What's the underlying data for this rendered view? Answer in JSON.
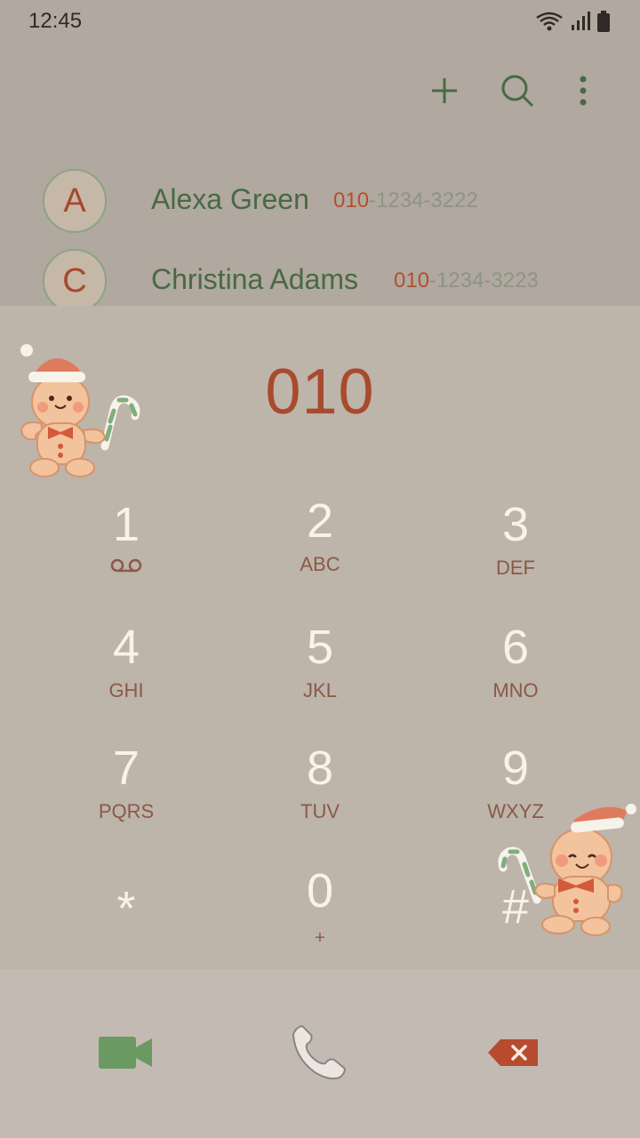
{
  "status_bar": {
    "time": "12:45"
  },
  "toolbar": {
    "icons": [
      "plus-icon",
      "search-icon",
      "more-vert-icon"
    ]
  },
  "contacts": [
    {
      "initial": "A",
      "name": "Alexa Green",
      "number_match": "010",
      "number_rest": "-1234-3222"
    },
    {
      "initial": "C",
      "name": "Christina Adams",
      "number_match": "010",
      "number_rest": "-1234-3223"
    }
  ],
  "dialer": {
    "number": "010"
  },
  "keys": [
    {
      "digit": "1",
      "letters": ""
    },
    {
      "digit": "2",
      "letters": "ABC"
    },
    {
      "digit": "3",
      "letters": "DEF"
    },
    {
      "digit": "4",
      "letters": "GHI"
    },
    {
      "digit": "5",
      "letters": "JKL"
    },
    {
      "digit": "6",
      "letters": "MNO"
    },
    {
      "digit": "7",
      "letters": "PQRS"
    },
    {
      "digit": "8",
      "letters": "TUV"
    },
    {
      "digit": "9",
      "letters": "WXYZ"
    },
    {
      "digit": "*",
      "letters": ""
    },
    {
      "digit": "0",
      "letters": "+"
    },
    {
      "digit": "#",
      "letters": ""
    }
  ],
  "bottom_bar": {
    "icons": [
      "video-call-icon",
      "phone-call-icon",
      "backspace-icon"
    ]
  },
  "colors": {
    "accent_green": "#466a45",
    "accent_red": "#a84a2e",
    "video_green": "#6a9a62",
    "backspace_red": "#b84a30"
  }
}
